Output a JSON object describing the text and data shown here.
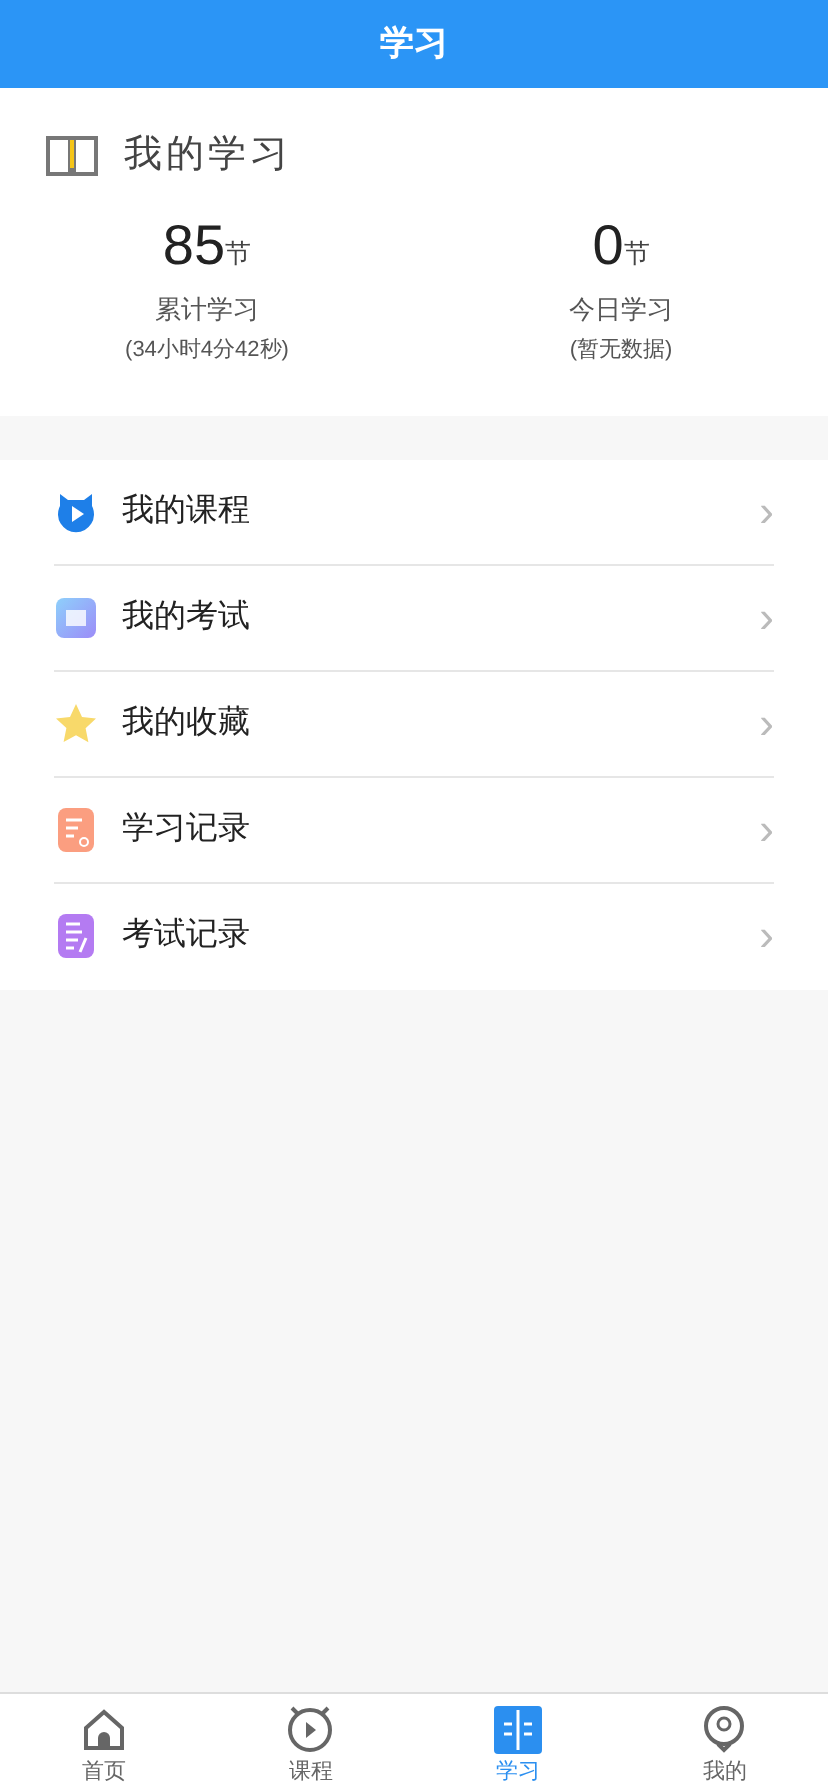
{
  "header": {
    "title": "学习"
  },
  "summary": {
    "title": "我的学习",
    "stats": [
      {
        "value": "85",
        "unit": "节",
        "label": "累计学习",
        "note": "(34小时4分42秒)"
      },
      {
        "value": "0",
        "unit": "节",
        "label": "今日学习",
        "note": "(暂无数据)"
      }
    ]
  },
  "menu": [
    {
      "kind": "course",
      "label": "我的课程",
      "chevron": "›"
    },
    {
      "kind": "exam",
      "label": "我的考试",
      "chevron": "›"
    },
    {
      "kind": "favorite",
      "label": "我的收藏",
      "chevron": "›"
    },
    {
      "kind": "study_log",
      "label": "学习记录",
      "chevron": "›"
    },
    {
      "kind": "exam_log",
      "label": "考试记录",
      "chevron": "›"
    }
  ],
  "tab_bar": [
    {
      "kind": "home",
      "label": "首页",
      "selected": false
    },
    {
      "kind": "course",
      "label": "课程",
      "selected": false
    },
    {
      "kind": "study",
      "label": "学习",
      "selected": true
    },
    {
      "kind": "me",
      "label": "我的",
      "selected": false
    }
  ]
}
